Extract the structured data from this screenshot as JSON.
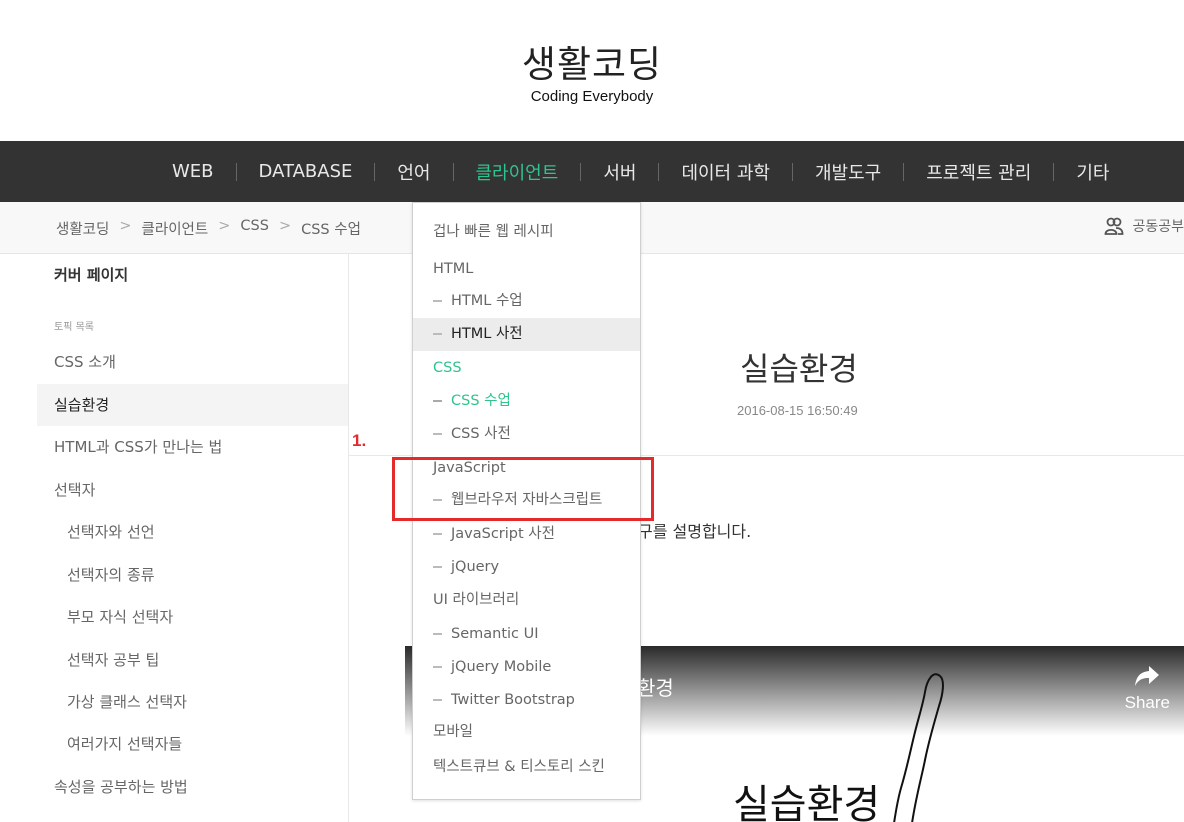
{
  "header": {
    "title": "생활코딩",
    "subtitle": "Coding Everybody"
  },
  "nav": {
    "items": [
      "WEB",
      "DATABASE",
      "언어",
      "클라이언트",
      "서버",
      "데이터 과학",
      "개발도구",
      "프로젝트 관리",
      "기타"
    ],
    "active": "클라이언트"
  },
  "breadcrumb": {
    "items": [
      "생활코딩",
      "클라이언트",
      "CSS",
      "CSS 수업"
    ],
    "separator": ">"
  },
  "study_link": {
    "label": "공동공부"
  },
  "sidebar": {
    "cover": "커버 페이지",
    "topic_label": "토픽 목록",
    "items": [
      "CSS 소개",
      "실습환경",
      "HTML과 CSS가 만나는 법",
      "선택자",
      "선택자와 선언",
      "선택자의 종류",
      "부모 자식 선택자",
      "선택자 공부 팁",
      "가상 클래스 선택자",
      "여러가지 선택자들",
      "속성을 공부하는 방법"
    ],
    "active": "실습환경"
  },
  "main": {
    "title": "실습환경",
    "date": "2016-08-15 16:50:49",
    "description_visible": "구를 설명합니다."
  },
  "annotation": {
    "label": "1."
  },
  "video": {
    "title": "환경",
    "share_label": "Share",
    "big_text": "실습환경"
  },
  "dropdown": {
    "items": [
      "겁나 빠른 웹 레시피",
      "HTML",
      "HTML 수업",
      "HTML 사전",
      "CSS",
      "CSS 수업",
      "CSS 사전",
      "JavaScript",
      "웹브라우저 자바스크립트",
      "JavaScript 사전",
      "jQuery",
      "UI 라이브러리",
      "Semantic UI",
      "jQuery Mobile",
      "Twitter Bootstrap",
      "모바일",
      "텍스트큐브 & 티스토리 스킨"
    ],
    "hovered": "HTML 사전",
    "active": [
      "CSS",
      "CSS 수업"
    ]
  },
  "colors": {
    "accent": "#2fc48e",
    "nav_bg": "#333333",
    "annotation": "#e42a2a"
  }
}
